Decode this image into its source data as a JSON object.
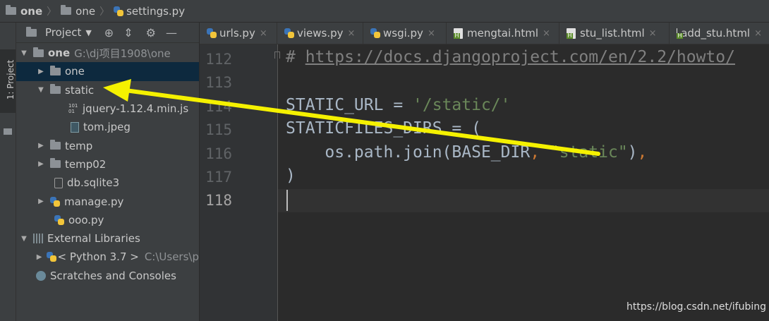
{
  "breadcrumb": {
    "items": [
      "one",
      "one",
      "settings.py"
    ]
  },
  "tool_window": {
    "vertical_tab": "1: Project",
    "title": "Project"
  },
  "tree": {
    "root": {
      "name": "one",
      "path": "G:\\dj项目1908\\one"
    },
    "one": "one",
    "static": "static",
    "jquery": "jquery-1.12.4.min.js",
    "tom": "tom.jpeg",
    "temp": "temp",
    "temp02": "temp02",
    "db": "db.sqlite3",
    "manage": "manage.py",
    "ooo": "ooo.py",
    "external": "External Libraries",
    "python": {
      "name": "< Python 3.7 >",
      "path": "C:\\Users\\p"
    },
    "scratches": "Scratches and Consoles"
  },
  "tabs": [
    {
      "label": "urls.py",
      "icon": "python-file-icon"
    },
    {
      "label": "views.py",
      "icon": "python-file-icon"
    },
    {
      "label": "wsgi.py",
      "icon": "python-file-icon"
    },
    {
      "label": "mengtai.html",
      "icon": "html-file-icon"
    },
    {
      "label": "stu_list.html",
      "icon": "html-file-icon"
    },
    {
      "label": "add_stu.html",
      "icon": "html-file-icon"
    }
  ],
  "gutter": {
    "lines": [
      "112",
      "113",
      "114",
      "115",
      "116",
      "117",
      "118"
    ],
    "current_line": "118"
  },
  "code": {
    "l112_hash": "# ",
    "l112_url": "https://docs.djangoproject.com/en/2.2/howto/",
    "l114_name": "STATIC_URL",
    "l114_eq": " = ",
    "l114_val": "'/static/'",
    "l115": "STATICFILES_DIRS = (",
    "l116_call": "    os.path.join(BASE_DIR",
    "l116_comma1": ", ",
    "l116_val": "\"static\"",
    "l116_close": ")",
    "l116_comma2": ",",
    "l117": ")"
  },
  "watermark": "https://blog.csdn.net/ifubing",
  "colors": {
    "arrow": "#f5f100",
    "selection": "#0d293e",
    "comment": "#808080",
    "string": "#6a8759",
    "keyword": "#cc7832"
  }
}
